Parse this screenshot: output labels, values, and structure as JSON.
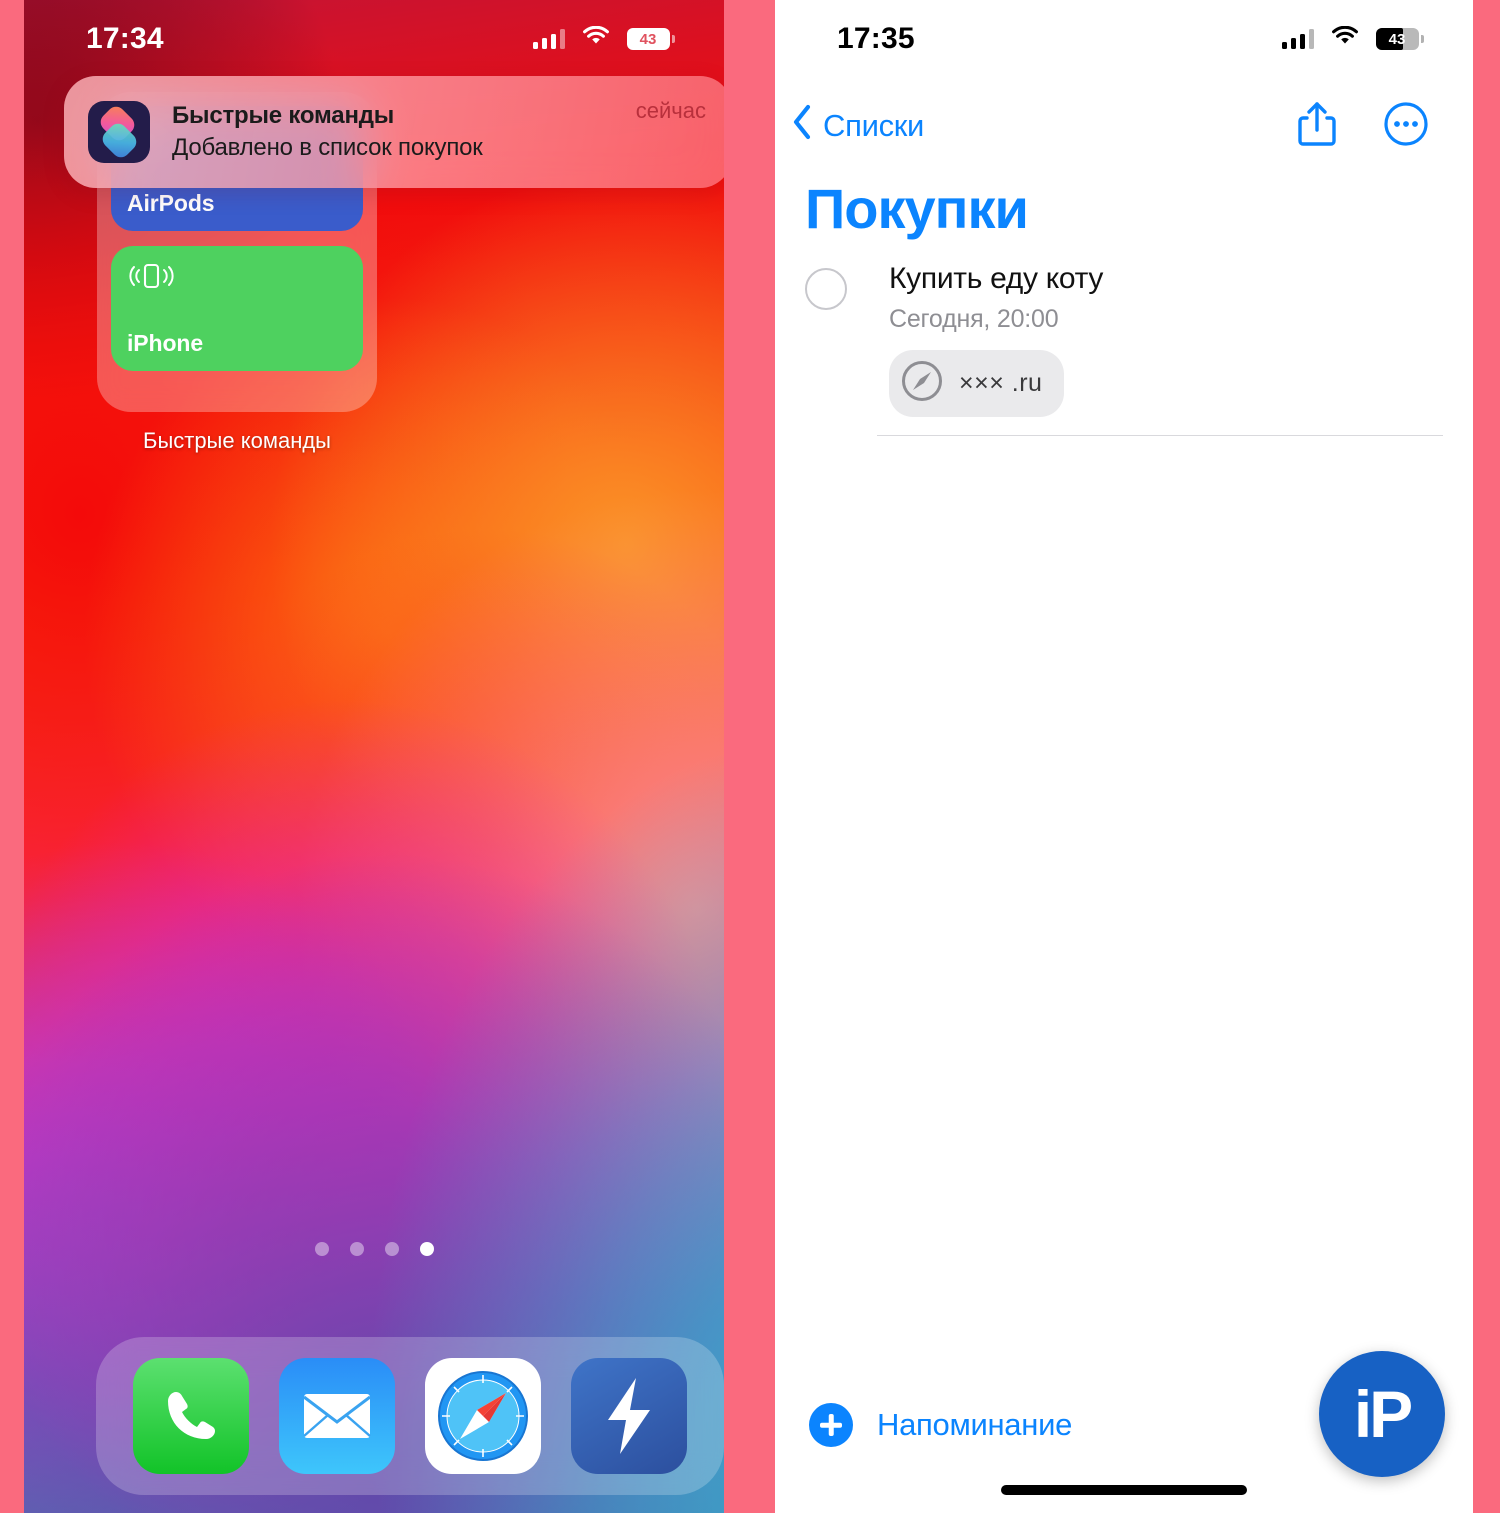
{
  "theme": {
    "page_background": "#fa6a7e",
    "ios_blue": "#0b84fe",
    "tile_airpods": "#3a5ccb",
    "tile_iphone": "#4ed15f",
    "notification_time_color": "#b8303c",
    "watermark_blue": "#1761c4"
  },
  "left_screen": {
    "status_bar": {
      "time": "17:34",
      "battery_percent": "43",
      "signal_icon": "cellular-signal-icon",
      "wifi_icon": "wifi-icon",
      "battery_icon": "battery-icon"
    },
    "notification": {
      "app_icon": "shortcuts-app-icon",
      "title": "Быстрые команды",
      "subtitle": "Добавлено в список покупок",
      "timestamp": "сейчас"
    },
    "widget": {
      "name": "Быстрые команды",
      "tiles": [
        {
          "label": "AirPods",
          "icon": "airpods-icon",
          "color": "#3a5ccb"
        },
        {
          "label": "iPhone",
          "icon": "iphone-vibrate-icon",
          "color": "#4ed15f"
        }
      ]
    },
    "page_dots": {
      "total": 4,
      "active_index": 3
    },
    "dock": [
      {
        "name": "phone-app-icon",
        "label": "Phone"
      },
      {
        "name": "mail-app-icon",
        "label": "Mail"
      },
      {
        "name": "safari-app-icon",
        "label": "Safari"
      },
      {
        "name": "shortcuts-app-icon",
        "label": "Shortcuts"
      }
    ]
  },
  "right_screen": {
    "status_bar": {
      "time": "17:35",
      "battery_percent": "43",
      "signal_icon": "cellular-signal-icon",
      "wifi_icon": "wifi-icon",
      "battery_icon": "battery-icon"
    },
    "nav": {
      "back_label": "Списки",
      "back_icon": "chevron-left-icon",
      "share_icon": "share-icon",
      "more_icon": "more-circle-icon"
    },
    "list_title": "Покупки",
    "reminders": [
      {
        "title": "Купить еду коту",
        "due": "Сегодня, 20:00",
        "link": {
          "icon": "safari-compass-icon",
          "text": "××× .ru"
        },
        "completed": false
      }
    ],
    "add_button": {
      "label": "Напоминание",
      "icon": "plus-circle-icon"
    },
    "watermark": {
      "text": "iP"
    }
  }
}
